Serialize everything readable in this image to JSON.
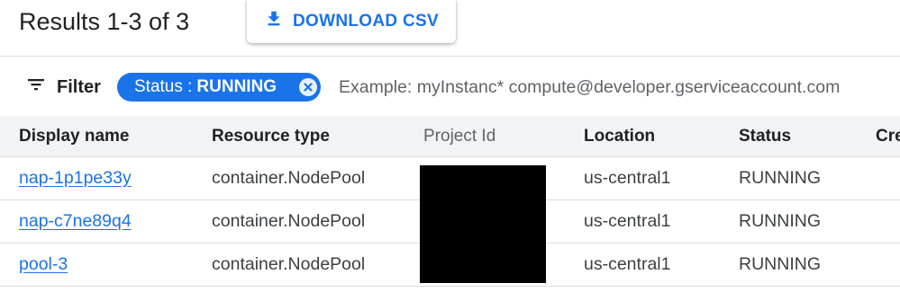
{
  "header": {
    "results_title": "Results 1-3 of 3",
    "download_label": "DOWNLOAD CSV"
  },
  "filter": {
    "label": "Filter",
    "chip_key": "Status :",
    "chip_value": "RUNNING",
    "input_placeholder": "Example: myInstanc* compute@developer.gserviceaccount.com",
    "input_value": ""
  },
  "table": {
    "columns": [
      "Display name",
      "Resource type",
      "Project Id",
      "Location",
      "Status",
      "Cre"
    ],
    "rows": [
      {
        "display_name": "nap-1p1pe33y",
        "resource_type": "container.NodePool",
        "location": "us-central1",
        "status": "RUNNING"
      },
      {
        "display_name": "nap-c7ne89q4",
        "resource_type": "container.NodePool",
        "location": "us-central1",
        "status": "RUNNING"
      },
      {
        "display_name": "pool-3",
        "resource_type": "container.NodePool",
        "location": "us-central1",
        "status": "RUNNING"
      }
    ]
  },
  "colors": {
    "accent": "#1a73e8",
    "header_bg": "#f1f3f4",
    "redaction": "#000000"
  }
}
